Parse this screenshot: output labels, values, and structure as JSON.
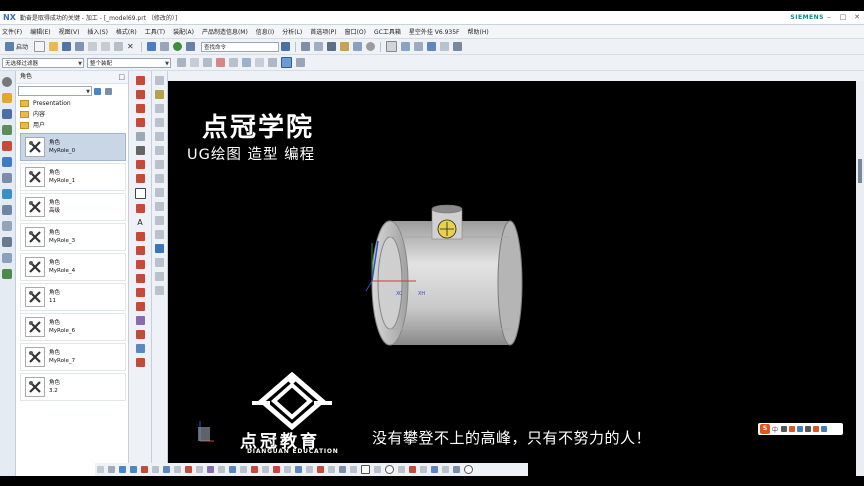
{
  "titlebar": {
    "app": "NX",
    "title": "勤奋是取得成功的关键 - 加工 - [_model69.prt （修改的）]",
    "brand": "SIEMENS",
    "min": "–",
    "max": "□",
    "close": "✕"
  },
  "menu": [
    "文件(F)",
    "编辑(E)",
    "视图(V)",
    "插入(S)",
    "格式(R)",
    "工具(T)",
    "装配(A)",
    "产品制造信息(M)",
    "信息(I)",
    "分析(L)",
    "首选项(P)",
    "窗口(O)",
    "GC工具箱",
    "星空外挂 V6.935F",
    "帮助(H)"
  ],
  "toolbar": {
    "start_label": "启动",
    "search_placeholder": "查找命令",
    "filter_value": "无选择过滤器",
    "assembly_value": "整个装配"
  },
  "panel": {
    "header": "角色",
    "folders": [
      "Presentation",
      "内容",
      "用户"
    ],
    "roles": [
      {
        "type": "角色",
        "name": "MyRole_0"
      },
      {
        "type": "角色",
        "name": "MyRole_1"
      },
      {
        "type": "角色",
        "name": "高级"
      },
      {
        "type": "角色",
        "name": "MyRole_3"
      },
      {
        "type": "角色",
        "name": "MyRole_4"
      },
      {
        "type": "角色",
        "name": "11"
      },
      {
        "type": "角色",
        "name": "MyRole_6"
      },
      {
        "type": "角色",
        "name": "MyRole_7"
      },
      {
        "type": "角色",
        "name": "3.2"
      }
    ]
  },
  "overlay": {
    "brand_title": "点冠学院",
    "brand_subtitle": "UG绘图 造型 编程",
    "logo_text": "点冠教育",
    "logo_en": "DIANGUAN EDUCATION",
    "slogan": "没有攀登不上的高峰，只有不努力的人！"
  },
  "model": {
    "axis_x1": "XC",
    "axis_x2": "XH"
  },
  "ime": {
    "badge": "S",
    "mode": "中"
  },
  "colors": {
    "viewport_bg": "#000000",
    "ui_bg": "#dfe6ef",
    "selected_role": "#c8d6e6",
    "brand_teal": "#0a8a8a",
    "ime_orange": "#e2541a"
  }
}
